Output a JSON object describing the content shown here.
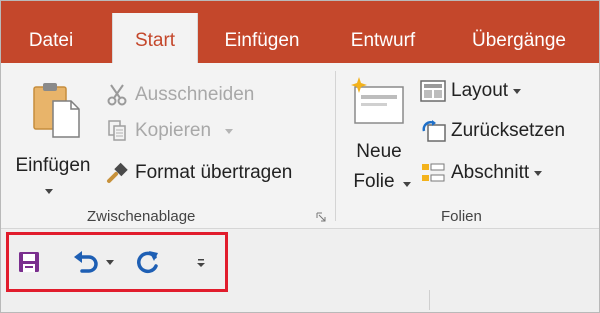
{
  "tabs": [
    {
      "label": "Datei",
      "active": false
    },
    {
      "label": "Start",
      "active": true
    },
    {
      "label": "Einfügen",
      "active": false
    },
    {
      "label": "Entwurf",
      "active": false
    },
    {
      "label": "Übergänge",
      "active": false
    }
  ],
  "clipboard": {
    "paste_label": "Einfügen",
    "cut_label": "Ausschneiden",
    "copy_label": "Kopieren",
    "format_painter_label": "Format übertragen",
    "group_label": "Zwischenablage"
  },
  "slides": {
    "new_slide_line1": "Neue",
    "new_slide_line2": "Folie",
    "layout_label": "Layout",
    "reset_label": "Zurücksetzen",
    "section_label": "Abschnitt",
    "group_label": "Folien"
  },
  "qat": {
    "save_icon": "save-icon",
    "undo_icon": "undo-icon",
    "redo_icon": "repeat-icon",
    "customize_icon": "customize-qat-icon"
  },
  "colors": {
    "accent": "#c4472b",
    "highlight_box": "#e11c2c",
    "qat_icon": "#1e5fb4",
    "save_icon": "#7a2f8e"
  }
}
